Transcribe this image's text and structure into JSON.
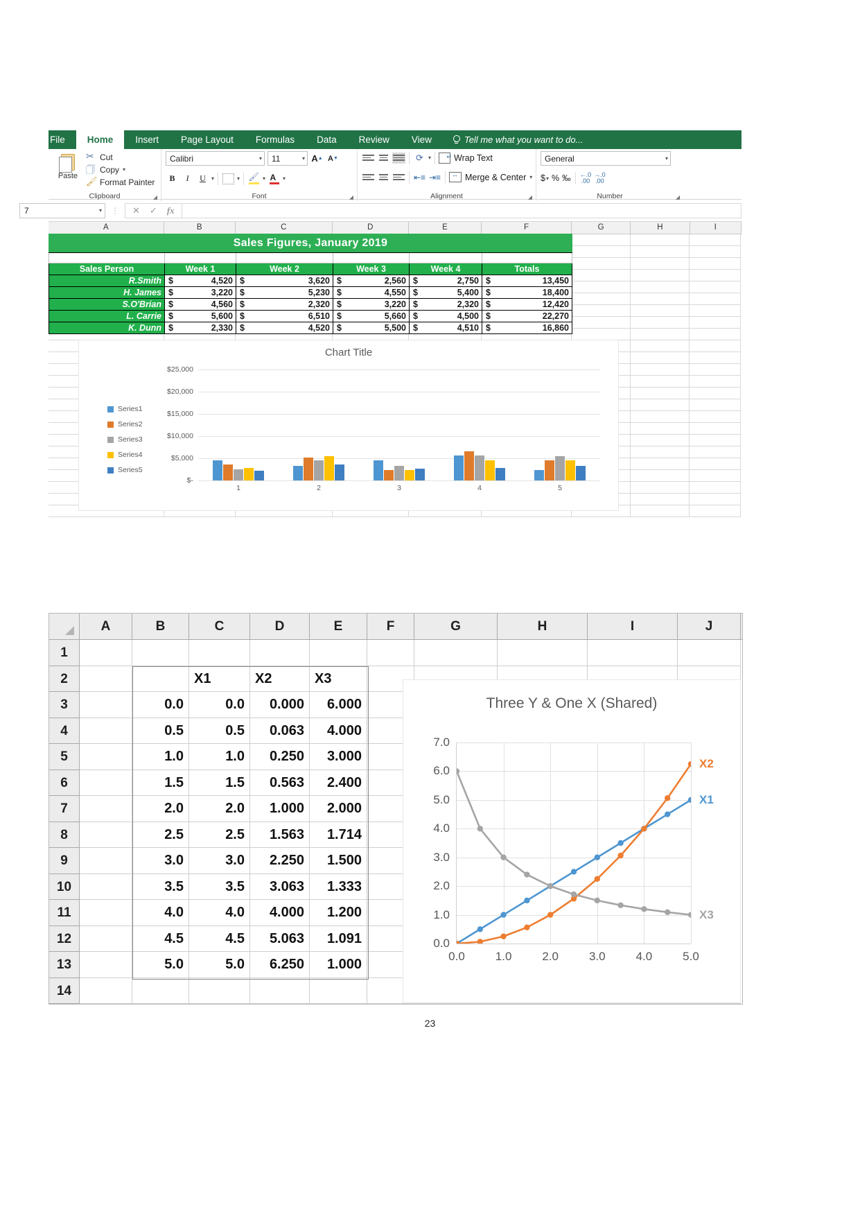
{
  "excel1": {
    "tabs": [
      {
        "label": "File",
        "active": false
      },
      {
        "label": "Home",
        "active": true
      },
      {
        "label": "Insert",
        "active": false
      },
      {
        "label": "Page Layout",
        "active": false
      },
      {
        "label": "Formulas",
        "active": false
      },
      {
        "label": "Data",
        "active": false
      },
      {
        "label": "Review",
        "active": false
      },
      {
        "label": "View",
        "active": false
      }
    ],
    "tell_me": "Tell me what you want to do...",
    "groups": {
      "clipboard": {
        "label": "Clipboard",
        "paste": "Paste",
        "cut": "Cut",
        "copy": "Copy",
        "format_painter": "Format Painter"
      },
      "font": {
        "label": "Font",
        "font_name": "Calibri",
        "font_size": "11",
        "bold": "B",
        "italic": "I",
        "underline": "U",
        "grow": "A",
        "shrink": "A"
      },
      "alignment": {
        "label": "Alignment",
        "wrap_text": "Wrap Text",
        "merge_center": "Merge & Center"
      },
      "number": {
        "label": "Number",
        "format": "General",
        "currency": "$",
        "percent": "%",
        "comma": "‰"
      }
    },
    "formula_bar": {
      "name_box": "7",
      "cancel": "✕",
      "enter": "✓",
      "fx": "fx",
      "value": ""
    },
    "columns": [
      "A",
      "B",
      "C",
      "D",
      "E",
      "F",
      "G",
      "H",
      "I"
    ],
    "table": {
      "title": "Sales Figures, January 2019",
      "headers": [
        "Sales Person",
        "Week 1",
        "Week 2",
        "Week 3",
        "Week 4",
        "Totals"
      ],
      "currency": "$",
      "rows": [
        {
          "name": "R.Smith",
          "w1": "4,520",
          "w2": "3,620",
          "w3": "2,560",
          "w4": "2,750",
          "total": "13,450"
        },
        {
          "name": "H. James",
          "w1": "3,220",
          "w2": "5,230",
          "w3": "4,550",
          "w4": "5,400",
          "total": "18,400"
        },
        {
          "name": "S.O'Brian",
          "w1": "4,560",
          "w2": "2,320",
          "w3": "3,220",
          "w4": "2,320",
          "total": "12,420"
        },
        {
          "name": "L. Carrie",
          "w1": "5,600",
          "w2": "6,510",
          "w3": "5,660",
          "w4": "4,500",
          "total": "22,270"
        },
        {
          "name": "K. Dunn",
          "w1": "2,330",
          "w2": "4,520",
          "w3": "5,500",
          "w4": "4,510",
          "total": "16,860"
        }
      ]
    }
  },
  "excel2": {
    "columns": [
      "A",
      "B",
      "C",
      "D",
      "E",
      "F",
      "G",
      "H",
      "I",
      "J"
    ],
    "rows": [
      "1",
      "2",
      "3",
      "4",
      "5",
      "6",
      "7",
      "8",
      "9",
      "10",
      "11",
      "12",
      "13",
      "14"
    ],
    "cells": [
      {
        "row": "1",
        "B": "",
        "C": "",
        "D": "",
        "E": ""
      },
      {
        "row": "2",
        "B": "",
        "C": "X1",
        "D": "X2",
        "E": "X3"
      },
      {
        "row": "3",
        "B": "0.0",
        "C": "0.0",
        "D": "0.000",
        "E": "6.000"
      },
      {
        "row": "4",
        "B": "0.5",
        "C": "0.5",
        "D": "0.063",
        "E": "4.000"
      },
      {
        "row": "5",
        "B": "1.0",
        "C": "1.0",
        "D": "0.250",
        "E": "3.000"
      },
      {
        "row": "6",
        "B": "1.5",
        "C": "1.5",
        "D": "0.563",
        "E": "2.400"
      },
      {
        "row": "7",
        "B": "2.0",
        "C": "2.0",
        "D": "1.000",
        "E": "2.000"
      },
      {
        "row": "8",
        "B": "2.5",
        "C": "2.5",
        "D": "1.563",
        "E": "1.714"
      },
      {
        "row": "9",
        "B": "3.0",
        "C": "3.0",
        "D": "2.250",
        "E": "1.500"
      },
      {
        "row": "10",
        "B": "3.5",
        "C": "3.5",
        "D": "3.063",
        "E": "1.333"
      },
      {
        "row": "11",
        "B": "4.0",
        "C": "4.0",
        "D": "4.000",
        "E": "1.200"
      },
      {
        "row": "12",
        "B": "4.5",
        "C": "4.5",
        "D": "5.063",
        "E": "1.091"
      },
      {
        "row": "13",
        "B": "5.0",
        "C": "5.0",
        "D": "6.250",
        "E": "1.000"
      },
      {
        "row": "14",
        "B": "",
        "C": "",
        "D": "",
        "E": ""
      }
    ]
  },
  "page_number": "23",
  "chart_data": [
    {
      "type": "bar",
      "title": "Chart Title",
      "xlabel": "",
      "ylabel": "",
      "categories": [
        "1",
        "2",
        "3",
        "4",
        "5"
      ],
      "ytick_labels": [
        "$25,000",
        "$20,000",
        "$15,000",
        "$10,000",
        "$5,000",
        "$-"
      ],
      "ylim": [
        0,
        25000
      ],
      "grid": true,
      "legend_position": "left",
      "series": [
        {
          "name": "Series1",
          "color": "#4e96d1",
          "values": [
            4520,
            3220,
            4560,
            5600,
            2330
          ]
        },
        {
          "name": "Series2",
          "color": "#df7b2a",
          "values": [
            3620,
            5230,
            2320,
            6510,
            4520
          ]
        },
        {
          "name": "Series3",
          "color": "#a5a5a5",
          "values": [
            2560,
            4550,
            3220,
            5660,
            5500
          ]
        },
        {
          "name": "Series4",
          "color": "#ffc000",
          "values": [
            2750,
            5400,
            2320,
            4500,
            4510
          ]
        },
        {
          "name": "Series5",
          "color": "#3f7fc1",
          "values": [
            2250,
            3600,
            2640,
            2780,
            3350
          ]
        }
      ]
    },
    {
      "type": "line",
      "title": "Three Y & One X (Shared)",
      "xlabel": "",
      "ylabel": "",
      "x": [
        0.0,
        0.5,
        1.0,
        1.5,
        2.0,
        2.5,
        3.0,
        3.5,
        4.0,
        4.5,
        5.0
      ],
      "xtick_labels": [
        "0.0",
        "1.0",
        "2.0",
        "3.0",
        "4.0",
        "5.0"
      ],
      "ytick_labels": [
        "0.0",
        "1.0",
        "2.0",
        "3.0",
        "4.0",
        "5.0",
        "6.0",
        "7.0"
      ],
      "xlim": [
        0,
        5
      ],
      "ylim": [
        0,
        7
      ],
      "grid": true,
      "markers": true,
      "legend_position": "right-of-plot-end-labels",
      "series": [
        {
          "name": "X1",
          "color": "#4e96d1",
          "values": [
            0.0,
            0.5,
            1.0,
            1.5,
            2.0,
            2.5,
            3.0,
            3.5,
            4.0,
            4.5,
            5.0
          ]
        },
        {
          "name": "X2",
          "color": "#ed7d31",
          "values": [
            0.0,
            0.063,
            0.25,
            0.563,
            1.0,
            1.563,
            2.25,
            3.063,
            4.0,
            5.063,
            6.25
          ]
        },
        {
          "name": "X3",
          "color": "#a5a5a5",
          "values": [
            6.0,
            4.0,
            3.0,
            2.4,
            2.0,
            1.714,
            1.5,
            1.333,
            1.2,
            1.091,
            1.0
          ]
        }
      ]
    }
  ]
}
